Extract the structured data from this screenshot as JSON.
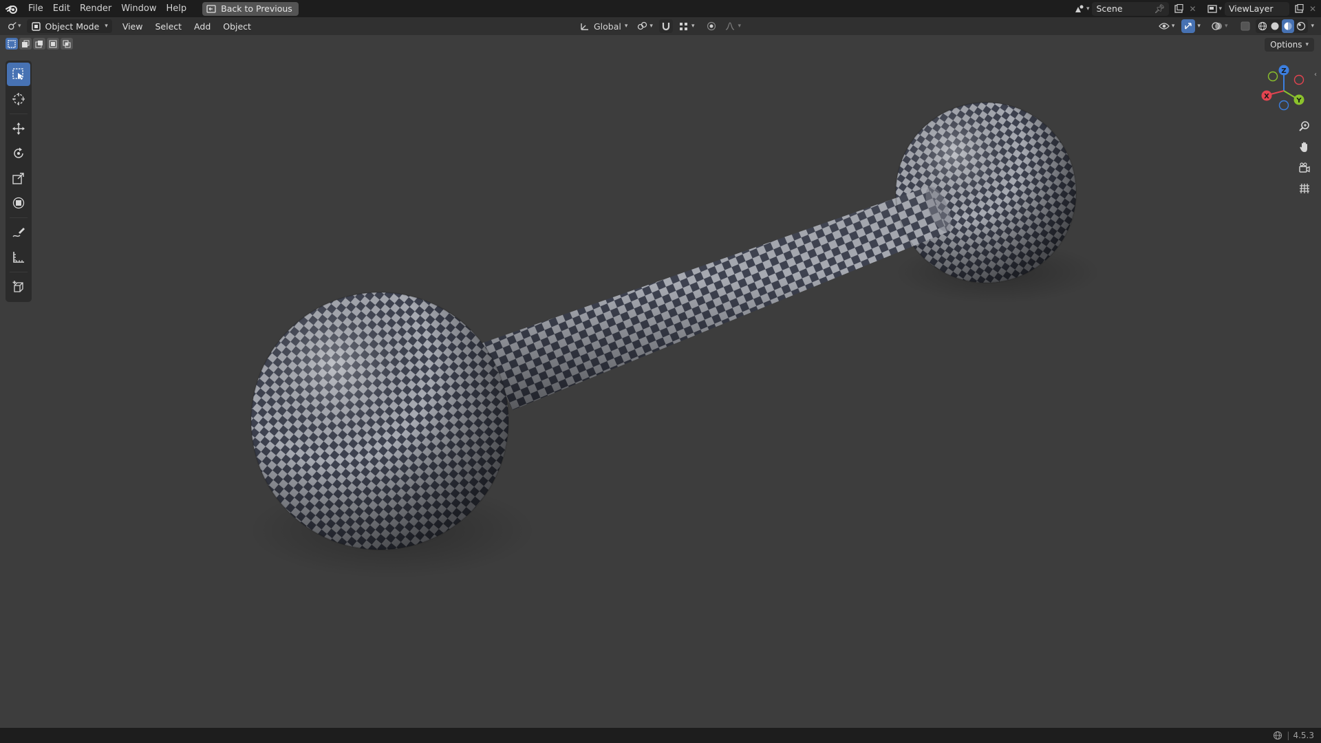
{
  "menu": {
    "items": [
      "File",
      "Edit",
      "Render",
      "Window",
      "Help"
    ],
    "back_button": "Back to Previous"
  },
  "top_right": {
    "scene": "Scene",
    "view_layer": "ViewLayer"
  },
  "header": {
    "mode": "Object Mode",
    "menus": [
      "View",
      "Select",
      "Add",
      "Object"
    ],
    "orientation": "Global"
  },
  "options": {
    "label": "Options"
  },
  "gizmo": {
    "x": "X",
    "y": "Y",
    "z": "Z"
  },
  "status": {
    "version": "4.5.3"
  },
  "colors": {
    "accent": "#4772b3",
    "viewport_bg": "#3d3d3d",
    "axis_x": "#e54450",
    "axis_y": "#8bc22c",
    "axis_z": "#3c7fe0"
  },
  "icons": {
    "toolbar": [
      "select-box-icon",
      "cursor-icon",
      "move-icon",
      "rotate-icon",
      "scale-icon",
      "transform-icon",
      "annotate-icon",
      "measure-icon",
      "add-cube-icon"
    ],
    "nav": [
      "zoom-icon",
      "pan-hand-icon",
      "camera-icon",
      "grid-icon"
    ]
  }
}
